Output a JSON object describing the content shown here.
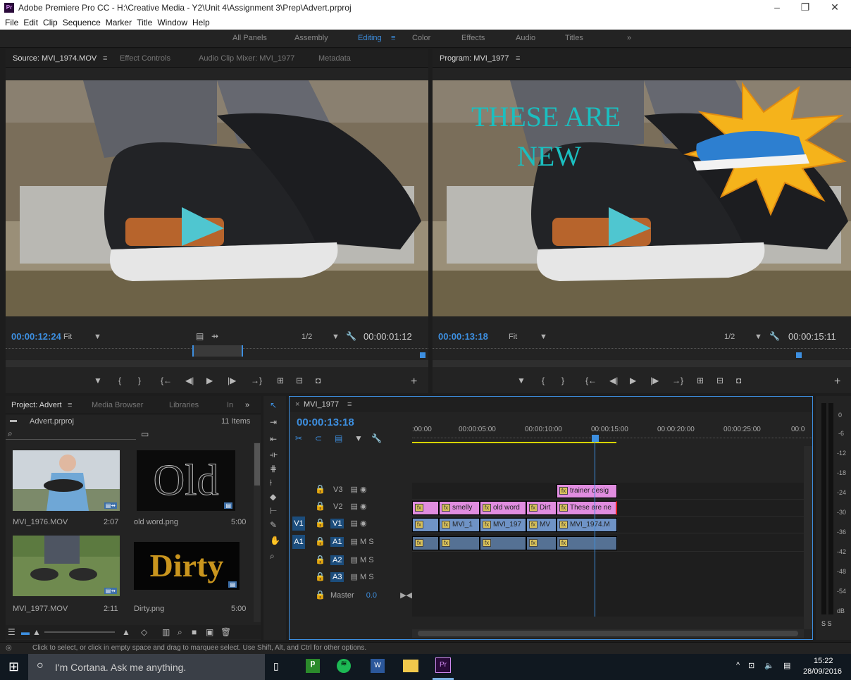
{
  "app": {
    "title": "Adobe Premiere Pro CC - H:\\Creative Media - Y2\\Unit 4\\Assignment 3\\Prep\\Advert.prproj",
    "logo": "Pr"
  },
  "menu": [
    "File",
    "Edit",
    "Clip",
    "Sequence",
    "Marker",
    "Title",
    "Window",
    "Help"
  ],
  "workspaces": [
    "All Panels",
    "Assembly",
    "Editing",
    "Color",
    "Effects",
    "Audio",
    "Titles"
  ],
  "workspace_active": "Editing",
  "source": {
    "tabs": [
      "Source: MVI_1974.MOV",
      "Effect Controls",
      "Audio Clip Mixer: MVI_1977",
      "Metadata"
    ],
    "timecode": "00:00:12:24",
    "fit": "Fit",
    "resolution": "1/2",
    "duration": "00:00:01:12"
  },
  "program": {
    "tab": "Program: MVI_1977",
    "timecode": "00:00:13:18",
    "fit": "Fit",
    "resolution": "1/2",
    "duration": "00:00:15:11",
    "overlay_line1": "THESE ARE",
    "overlay_line2": "NEW"
  },
  "project": {
    "tabs": [
      "Project: Advert",
      "Media Browser",
      "Libraries",
      "In"
    ],
    "file": "Advert.prproj",
    "count": "11 Items",
    "items": [
      {
        "name": "MVI_1976.MOV",
        "dur": "2:07"
      },
      {
        "name": "old word.png",
        "dur": "5:00"
      },
      {
        "name": "MVI_1977.MOV",
        "dur": "2:11"
      },
      {
        "name": "Dirty.png",
        "dur": "5:00"
      }
    ],
    "thumb_text_old": "Old",
    "thumb_text_dirty": "Dirty"
  },
  "timeline": {
    "tab": "MVI_1977",
    "timecode": "00:00:13:18",
    "ruler": [
      ":00:00",
      "00:00:05:00",
      "00:00:10:00",
      "00:00:15:00",
      "00:00:20:00",
      "00:00:25:00",
      "00:0"
    ],
    "tracks": [
      {
        "lock": "V3",
        "name": "V3"
      },
      {
        "lock": "V2",
        "name": "V2"
      },
      {
        "src": "V1",
        "name": "V1"
      },
      {
        "src": "A1",
        "name": "A1"
      },
      {
        "name": "A2"
      },
      {
        "name": "A3"
      }
    ],
    "master": "Master",
    "master_val": "0.0",
    "clips_v3": [
      "trainer desig"
    ],
    "clips_v2": [
      "",
      "smelly",
      "old word",
      "Dirt",
      "These are ne"
    ],
    "clips_v1": [
      "",
      "MVI_1",
      "MVI_197",
      "MV",
      "MVI_1974.M"
    ]
  },
  "meters": {
    "ticks": [
      "0",
      "-6",
      "-12",
      "-18",
      "-24",
      "-30",
      "-36",
      "-42",
      "-48",
      "-54",
      "dB"
    ],
    "solo": "S S"
  },
  "status": "Click to select, or click in empty space and drag to marquee select. Use Shift, Alt, and Ctrl for other options.",
  "taskbar": {
    "cortana": "I'm Cortana. Ask me anything.",
    "time": "15:22",
    "date": "28/09/2016"
  }
}
